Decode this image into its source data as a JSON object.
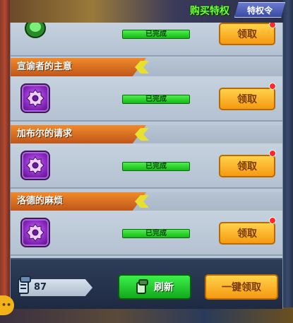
{
  "header": {
    "buy_privilege_link": "购买特权",
    "privilege_tab": "特权令"
  },
  "colors": {
    "accent_orange": "#e8761f",
    "progress_green": "#22c522",
    "claim_gold": "#f5b528",
    "notification_red": "#ff2a2a"
  },
  "quests": [
    {
      "title": "",
      "status": "已完成",
      "claim_label": "领取",
      "icon": "green-gem-icon",
      "has_notification": true
    },
    {
      "title": "宣谕者的主意",
      "status": "已完成",
      "claim_label": "领取",
      "icon": "purple-gear-icon",
      "has_notification": true
    },
    {
      "title": "加布尔的请求",
      "status": "已完成",
      "claim_label": "领取",
      "icon": "purple-gear-icon",
      "has_notification": true
    },
    {
      "title": "洛德的麻烦",
      "status": "已完成",
      "claim_label": "领取",
      "icon": "purple-gear-icon",
      "has_notification": true
    }
  ],
  "footer": {
    "ticket_count": "87",
    "refresh_label": "刷新",
    "claim_all_label": "一键领取"
  },
  "chat_bubble": "••"
}
